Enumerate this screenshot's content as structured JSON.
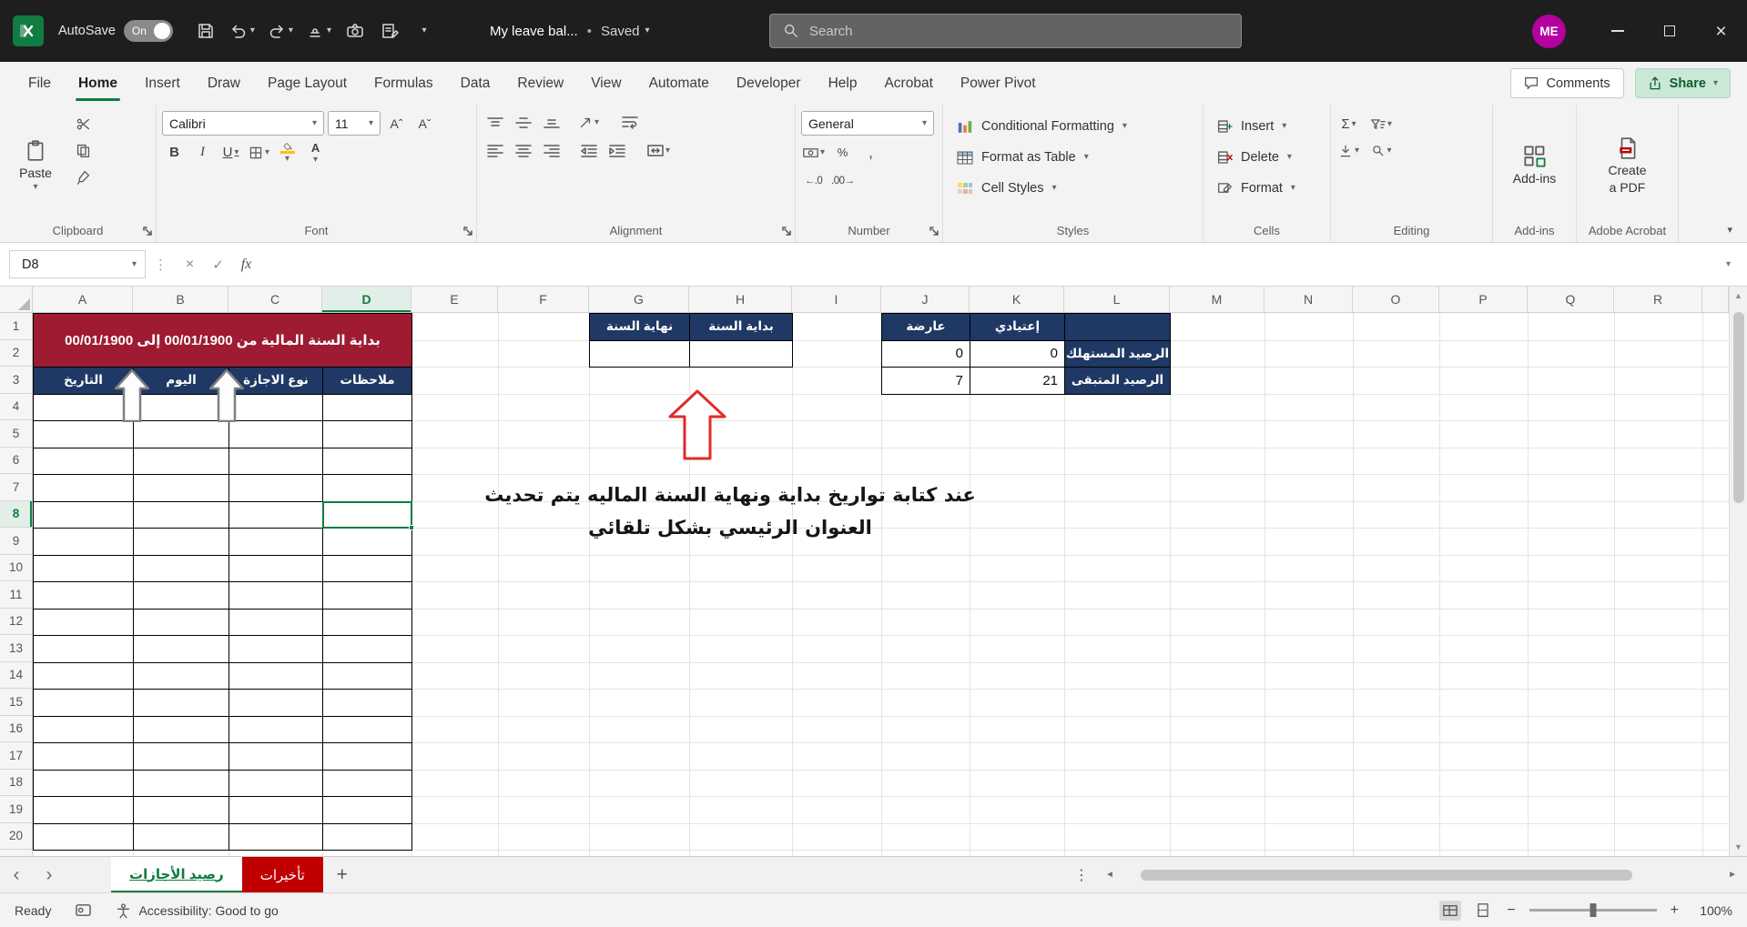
{
  "colors": {
    "accent_green": "#107C41",
    "title_maroon": "#9E1B32",
    "header_navy": "#1F3864",
    "tab_red": "#C00000",
    "arrow_red": "#E02B2B",
    "arrow_gray": "#7F7F7F",
    "avatar_magenta": "#B4009E"
  },
  "glyphs": {
    "chevron_down": "▾",
    "more_vertical": "⋮",
    "nav_left": "‹",
    "nav_right": "›",
    "add_sheet": "+",
    "scroll_left": "◄",
    "scroll_right": "►",
    "scroll_up": "▲",
    "scroll_down": "▼",
    "zoom_out": "−",
    "zoom_in": "+",
    "close_window": "×",
    "cancel": "×",
    "check": "✓",
    "fx": "fx",
    "bold": "B",
    "italic": "I",
    "underline": "U",
    "font_color": "A",
    "grow_font": "Aˆ",
    "shrink_font": "Aˇ",
    "autosum": "Σ",
    "percent": "%",
    "comma_style": ",",
    "increase_decimal": "←.0",
    "decrease_decimal": ".00→",
    "title_separator": "•"
  },
  "titlebar": {
    "autosave_label": "AutoSave",
    "autosave_state": "On",
    "doc_title": "My leave bal...",
    "save_status": "Saved",
    "search_placeholder": "Search",
    "avatar_initials": "ME"
  },
  "ribbon_tabs": {
    "tabs": [
      "File",
      "Home",
      "Insert",
      "Draw",
      "Page Layout",
      "Formulas",
      "Data",
      "Review",
      "View",
      "Automate",
      "Developer",
      "Help",
      "Acrobat",
      "Power Pivot"
    ],
    "active": "Home",
    "comments_label": "Comments",
    "share_label": "Share"
  },
  "ribbon": {
    "clipboard": {
      "paste_label": "Paste",
      "group_label": "Clipboard"
    },
    "font": {
      "font_name": "Calibri",
      "font_size": "11",
      "group_label": "Font"
    },
    "alignment": {
      "group_label": "Alignment"
    },
    "number": {
      "format": "General",
      "group_label": "Number"
    },
    "styles": {
      "conditional_formatting": "Conditional Formatting",
      "format_as_table": "Format as Table",
      "cell_styles": "Cell Styles",
      "group_label": "Styles"
    },
    "cells": {
      "insert": "Insert",
      "delete": "Delete",
      "format": "Format",
      "group_label": "Cells"
    },
    "editing": {
      "group_label": "Editing"
    },
    "addins": {
      "button_label": "Add-ins",
      "group_label": "Add-ins"
    },
    "adobe": {
      "button_label_line1": "Create",
      "button_label_line2": "a PDF",
      "group_label": "Adobe Acrobat"
    }
  },
  "formula_bar": {
    "name_box": "D8",
    "formula_value": ""
  },
  "grid": {
    "column_letters": [
      "A",
      "B",
      "C",
      "D",
      "E",
      "F",
      "G",
      "H",
      "I",
      "J",
      "K",
      "L",
      "M",
      "N",
      "O",
      "P",
      "Q",
      "R"
    ],
    "row_count": 20,
    "fiscal_title": "بداية السنة المالية من 00/01/1900 إلى 00/01/1900",
    "leave_table_headers": [
      "التاريخ",
      "اليوم",
      "نوع الاجازة",
      "ملاحظات"
    ],
    "year_end_header": "نهاية السنة",
    "year_start_header": "بداية السنة",
    "balance": {
      "col_casual": "عارضة",
      "col_regular": "إعتيادي",
      "row_used_label": "الرصيد المستهلك",
      "row_remaining_label": "الرصيد المتبقى",
      "used_casual": "0",
      "used_regular": "0",
      "remaining_casual": "7",
      "remaining_regular": "21"
    },
    "annotation_line1": "عند كتابة تواريخ بداية ونهاية السنة الماليه يتم تحديث",
    "annotation_line2": "العنوان الرئيسي بشكل تلقائي"
  },
  "sheet_bar": {
    "tabs": [
      {
        "label": "رصيد الأجازات",
        "active": true
      },
      {
        "label": "تأخيرات",
        "active": false
      }
    ]
  },
  "status_bar": {
    "ready_label": "Ready",
    "accessibility_label": "Accessibility: Good to go",
    "zoom_level": "100%"
  }
}
